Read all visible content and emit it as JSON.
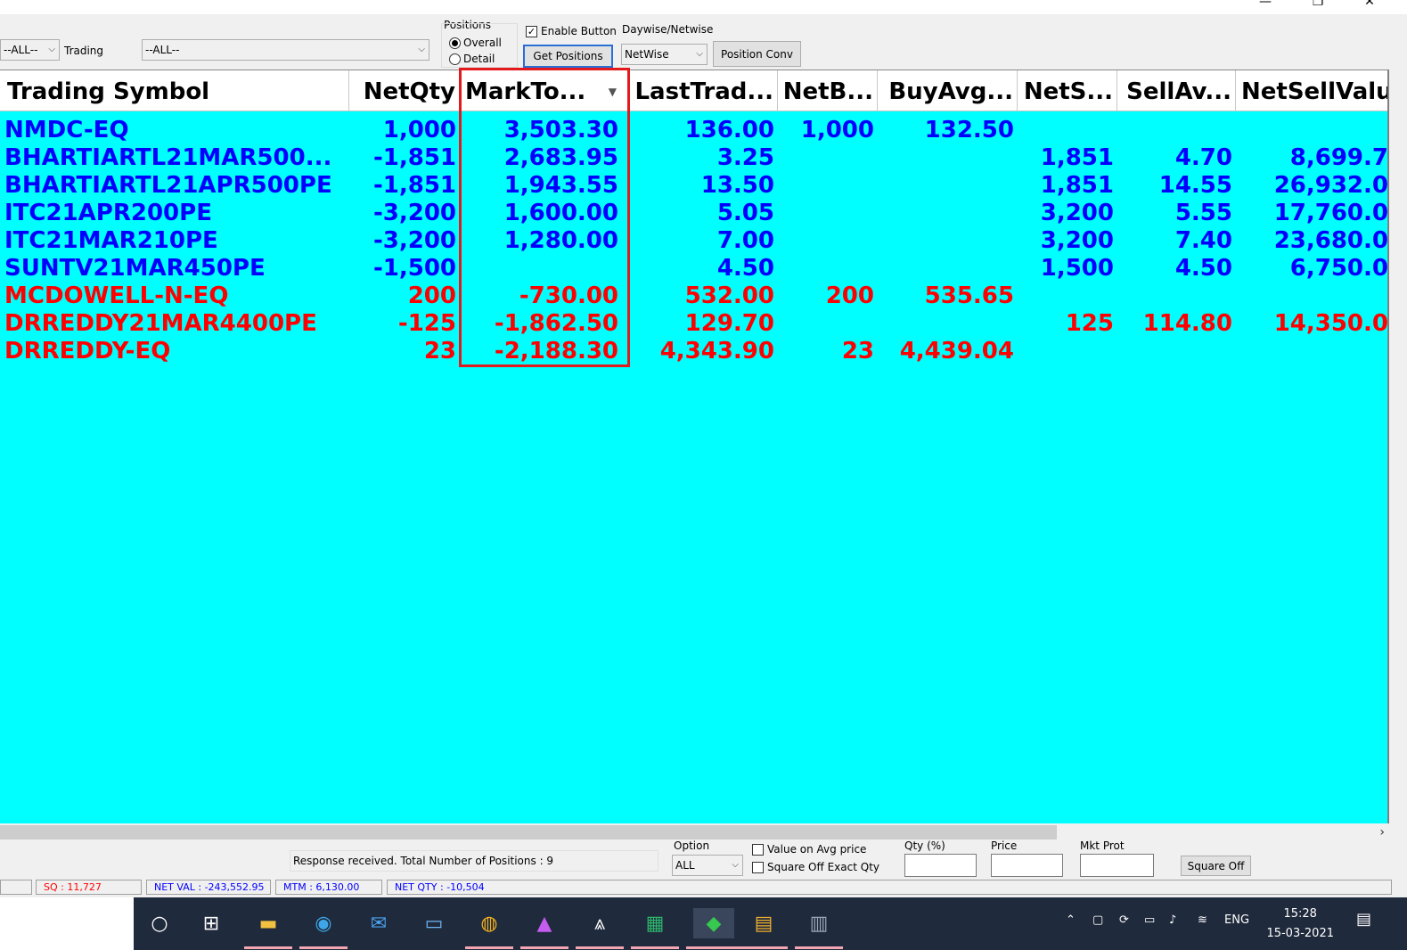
{
  "toolbar": {
    "exchange_value": "--ALL--",
    "trading_label": "Trading",
    "trading_value": "--ALL--",
    "positions_label": "Positions",
    "overall_label": "Overall",
    "detail_label": "Detail",
    "enable_button_label": "Enable Button",
    "enable_checked": "✓",
    "daywise_label": "Daywise/Netwise",
    "get_positions_label": "Get Positions",
    "netwise_value": "NetWise",
    "position_conv_label": "Position Conv"
  },
  "grid": {
    "columns": [
      "Trading Symbol",
      "NetQty",
      "MarkTo...",
      "LastTrad...",
      "NetB...",
      "BuyAvg...",
      "NetS...",
      "SellAv...",
      "NetSellValu"
    ],
    "rows": [
      {
        "color": "#0000ff",
        "cells": [
          "NMDC-EQ",
          "1,000",
          "3,503.30",
          "136.00",
          "1,000",
          "132.50",
          "",
          "",
          ""
        ]
      },
      {
        "color": "#0000ff",
        "cells": [
          "BHARTIARTL21MAR500...",
          "-1,851",
          "2,683.95",
          "3.25",
          "",
          "",
          "1,851",
          "4.70",
          "8,699.7"
        ]
      },
      {
        "color": "#0000ff",
        "cells": [
          "BHARTIARTL21APR500PE",
          "-1,851",
          "1,943.55",
          "13.50",
          "",
          "",
          "1,851",
          "14.55",
          "26,932.0"
        ]
      },
      {
        "color": "#0000ff",
        "cells": [
          "ITC21APR200PE",
          "-3,200",
          "1,600.00",
          "5.05",
          "",
          "",
          "3,200",
          "5.55",
          "17,760.0"
        ]
      },
      {
        "color": "#0000ff",
        "cells": [
          "ITC21MAR210PE",
          "-3,200",
          "1,280.00",
          "7.00",
          "",
          "",
          "3,200",
          "7.40",
          "23,680.0"
        ]
      },
      {
        "color": "#0000ff",
        "cells": [
          "SUNTV21MAR450PE",
          "-1,500",
          "",
          "4.50",
          "",
          "",
          "1,500",
          "4.50",
          "6,750.0"
        ]
      },
      {
        "color": "#ff0000",
        "cells": [
          "MCDOWELL-N-EQ",
          "200",
          "-730.00",
          "532.00",
          "200",
          "535.65",
          "",
          "",
          ""
        ]
      },
      {
        "color": "#ff0000",
        "cells": [
          "DRREDDY21MAR4400PE",
          "-125",
          "-1,862.50",
          "129.70",
          "",
          "",
          "125",
          "114.80",
          "14,350.0"
        ]
      },
      {
        "color": "#ff0000",
        "cells": [
          "DRREDDY-EQ",
          "23",
          "-2,188.30",
          "4,343.90",
          "23",
          "4,439.04",
          "",
          "",
          ""
        ]
      }
    ]
  },
  "bottom": {
    "status_message": "Response received.  Total Number of Positions : 9",
    "option_label": "Option",
    "option_value": "ALL",
    "value_on_avg_label": "Value on Avg  price",
    "square_off_exact_label": "Square Off Exact Qty",
    "qty_label": "Qty (%)",
    "price_label": "Price",
    "mkt_prot_label": "Mkt Prot",
    "square_off_label": "Square Off"
  },
  "statusbar": {
    "sq": "SQ : 11,727",
    "net_val": "NET VAL : -243,552.95",
    "mtm": "MTM : 6,130.00",
    "net_qty": "NET QTY : -10,504"
  },
  "taskbar": {
    "lang": "ENG",
    "time": "15:28",
    "date": "15-03-2021"
  }
}
